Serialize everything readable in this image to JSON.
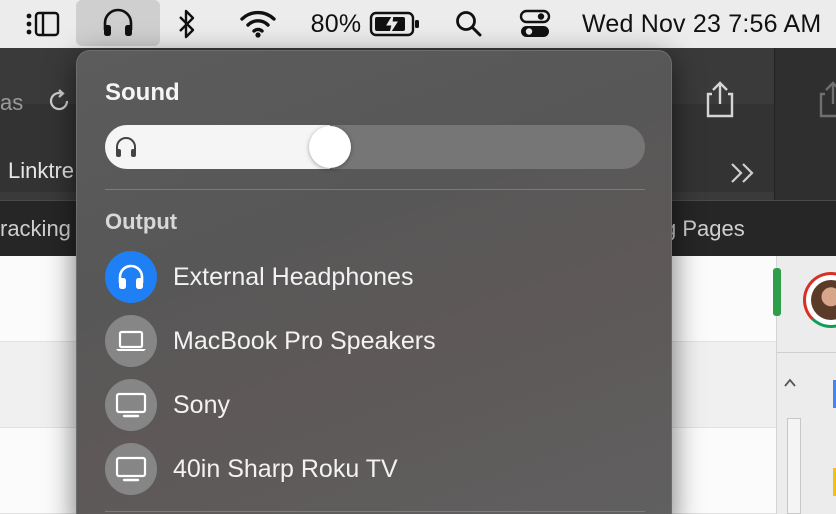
{
  "menubar": {
    "battery_percent": "80%",
    "datetime": "Wed Nov 23  7:56 AM"
  },
  "browser": {
    "address_fragment": "as",
    "bookmark_label": "Linktre",
    "tab_left": "racking",
    "tab_right": "g Pages"
  },
  "sound": {
    "title": "Sound",
    "volume_percent": 41,
    "output_label": "Output",
    "devices": [
      {
        "label": "External Headphones",
        "icon": "headphones-icon",
        "selected": true
      },
      {
        "label": "MacBook Pro Speakers",
        "icon": "laptop-icon",
        "selected": false
      },
      {
        "label": "Sony",
        "icon": "display-icon",
        "selected": false
      },
      {
        "label": "40in Sharp Roku TV",
        "icon": "display-icon",
        "selected": false
      }
    ]
  },
  "colors": {
    "selected_device": "#1f7ff5",
    "popover": "#5c5c5c",
    "menubar": "#ececec"
  }
}
